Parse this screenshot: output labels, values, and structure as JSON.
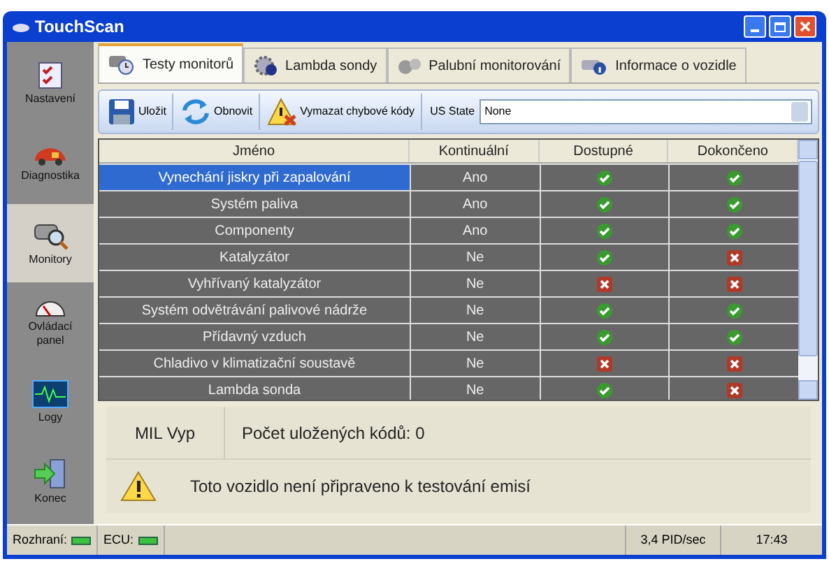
{
  "window": {
    "title": "TouchScan"
  },
  "sidebar": {
    "items": [
      {
        "label": "Nastavení",
        "selected": false
      },
      {
        "label": "Diagnostika",
        "selected": false
      },
      {
        "label": "Monitory",
        "selected": true
      },
      {
        "label": "Ovládací panel",
        "selected": false
      },
      {
        "label": "Logy",
        "selected": false
      },
      {
        "label": "Konec",
        "selected": false
      }
    ]
  },
  "tabs": [
    {
      "label": "Testy monitorů",
      "selected": true
    },
    {
      "label": "Lambda sondy",
      "selected": false
    },
    {
      "label": "Palubní monitorování",
      "selected": false
    },
    {
      "label": "Informace o vozidle",
      "selected": false
    }
  ],
  "toolbar": {
    "buttons": [
      {
        "label": "Uložit"
      },
      {
        "label": "Obnovit"
      },
      {
        "label": "Vymazat chybové kódy"
      }
    ],
    "state_label": "US State",
    "state_value": "None"
  },
  "table": {
    "columns": [
      "Jméno",
      "Kontinuální",
      "Dostupné",
      "Dokončeno"
    ],
    "rows": [
      {
        "name": "Vynechání jiskry při zapalování",
        "continuous": "Ano",
        "available": true,
        "completed": true,
        "selected": true
      },
      {
        "name": "Systém paliva",
        "continuous": "Ano",
        "available": true,
        "completed": true,
        "selected": false
      },
      {
        "name": "Componenty",
        "continuous": "Ano",
        "available": true,
        "completed": true,
        "selected": false
      },
      {
        "name": "Katalyzátor",
        "continuous": "Ne",
        "available": true,
        "completed": false,
        "selected": false
      },
      {
        "name": "Vyhřívaný katalyzátor",
        "continuous": "Ne",
        "available": false,
        "completed": false,
        "selected": false
      },
      {
        "name": "Systém odvětrávání palivové nádrže",
        "continuous": "Ne",
        "available": true,
        "completed": true,
        "selected": false
      },
      {
        "name": "Přídavný vzduch",
        "continuous": "Ne",
        "available": true,
        "completed": true,
        "selected": false
      },
      {
        "name": "Chladivo v klimatizační soustavě",
        "continuous": "Ne",
        "available": false,
        "completed": false,
        "selected": false
      },
      {
        "name": "Lambda sonda",
        "continuous": "Ne",
        "available": true,
        "completed": false,
        "selected": false
      }
    ]
  },
  "mil": {
    "status": "MIL Vyp",
    "codes": "Počet uložených kódů: 0"
  },
  "warning": "Toto vozidlo není připraveno k testování emisí",
  "status_bar": {
    "interface_label": "Rozhraní:",
    "interface_ok": true,
    "ecu_label": "ECU:",
    "ecu_ok": true,
    "rate": "3,4 PID/sec",
    "time": "17:43"
  }
}
